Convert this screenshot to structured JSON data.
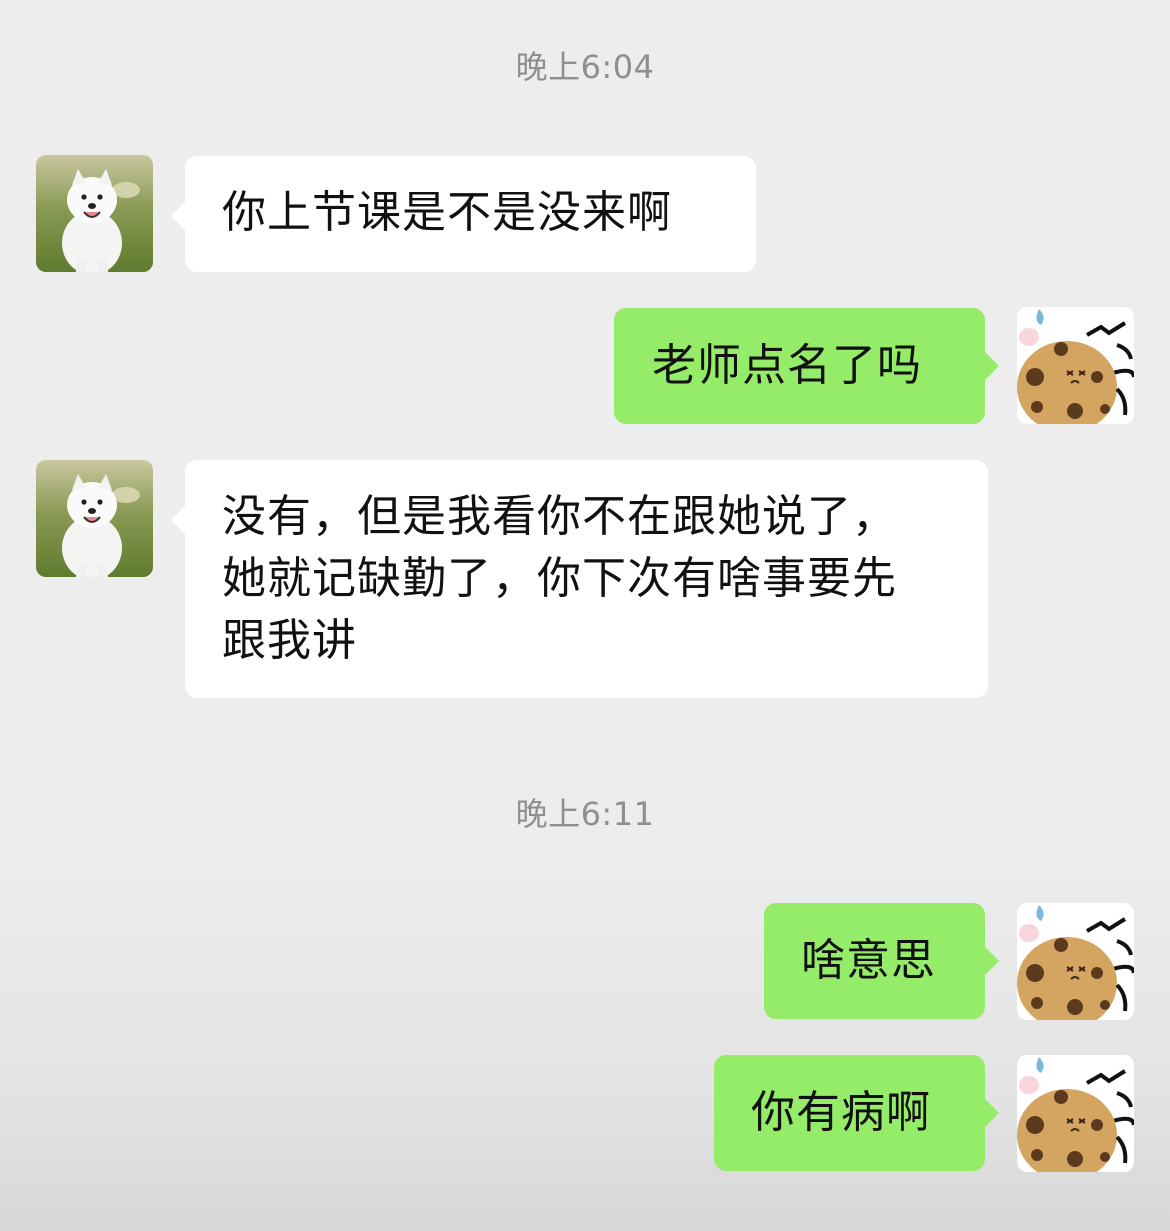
{
  "timestamps": [
    "晚上6:04",
    "晚上6:11"
  ],
  "messages": [
    {
      "from": "friend",
      "avatar": "samoyed-dog-avatar",
      "text": "你上节课是不是没来啊"
    },
    {
      "from": "me",
      "avatar": "cookie-cartoon-avatar",
      "text": "老师点名了吗"
    },
    {
      "from": "friend",
      "avatar": "samoyed-dog-avatar",
      "text": "没有，但是我看你不在跟她说了，\n她就记缺勤了，你下次有啥事要先\n跟我讲"
    },
    {
      "from": "me",
      "avatar": "cookie-cartoon-avatar",
      "text": "啥意思"
    },
    {
      "from": "me",
      "avatar": "cookie-cartoon-avatar",
      "text": "你有病啊"
    }
  ],
  "colors": {
    "background": "#ededed",
    "incoming_bubble": "#ffffff",
    "outgoing_bubble": "#95ec69",
    "timestamp_text": "#8f8f8f"
  }
}
